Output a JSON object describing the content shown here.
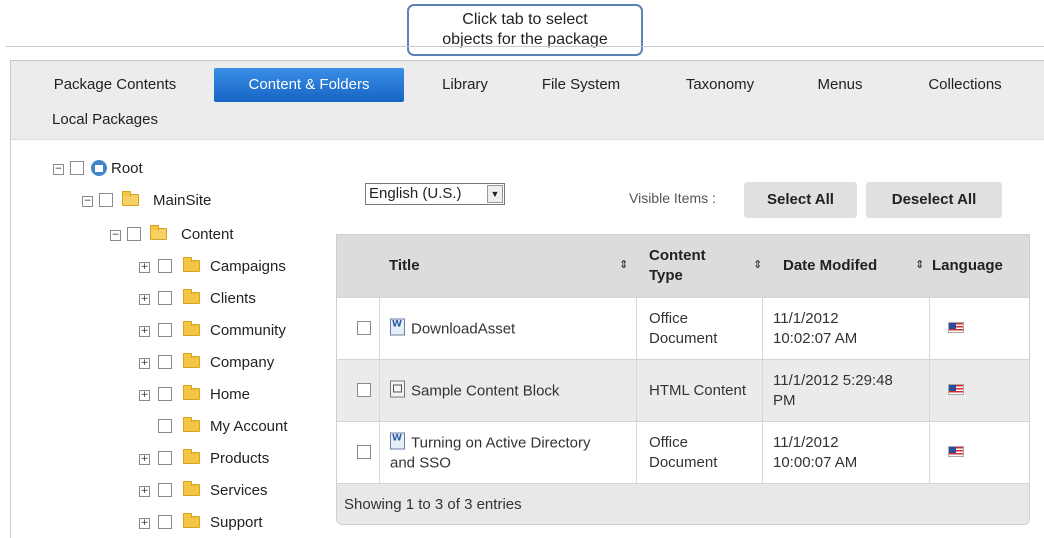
{
  "callout": {
    "line1": "Click tab to select",
    "line2": "objects for the package"
  },
  "tabs": [
    {
      "label": "Package Contents"
    },
    {
      "label": "Content & Folders"
    },
    {
      "label": "Library"
    },
    {
      "label": "File System"
    },
    {
      "label": "Taxonomy"
    },
    {
      "label": "Menus"
    },
    {
      "label": "Collections"
    },
    {
      "label": "Local Packages"
    }
  ],
  "active_tab": "Content & Folders",
  "tree": {
    "root": "Root",
    "mainsite": "MainSite",
    "content": "Content",
    "folders": [
      "Campaigns",
      "Clients",
      "Community",
      "Company",
      "Home",
      "My Account",
      "Products",
      "Services",
      "Support"
    ]
  },
  "toolbar": {
    "language": "English (U.S.)",
    "visible_items_label": "Visible Items :",
    "select_all": "Select All",
    "deselect_all": "Deselect All"
  },
  "grid": {
    "columns": {
      "title": "Title",
      "content_type_1": "Content",
      "content_type_2": "Type",
      "date_modified": "Date Modifed",
      "language": "Language"
    },
    "rows": [
      {
        "title": "DownloadAsset",
        "title2": "",
        "type1": "Office",
        "type2": "Document",
        "date1": "11/1/2012",
        "date2": "10:02:07 AM",
        "icon": "word-document-icon"
      },
      {
        "title": "Sample Content Block",
        "title2": "",
        "type1": "HTML Content",
        "type2": "",
        "date1": "11/1/2012 5:29:48",
        "date2": "PM",
        "icon": "html-content-icon"
      },
      {
        "title": "Turning on Active Directory",
        "title2": "and SSO",
        "type1": "Office",
        "type2": "Document",
        "date1": "11/1/2012",
        "date2": "10:00:07 AM",
        "icon": "word-document-icon"
      }
    ],
    "footer": "Showing 1 to 3 of 3 entries"
  },
  "colors": {
    "active_tab": "#1a6fd0",
    "tab_bar": "#ececec",
    "header": "#dcdcdc",
    "callout_border": "#5a84b8"
  }
}
